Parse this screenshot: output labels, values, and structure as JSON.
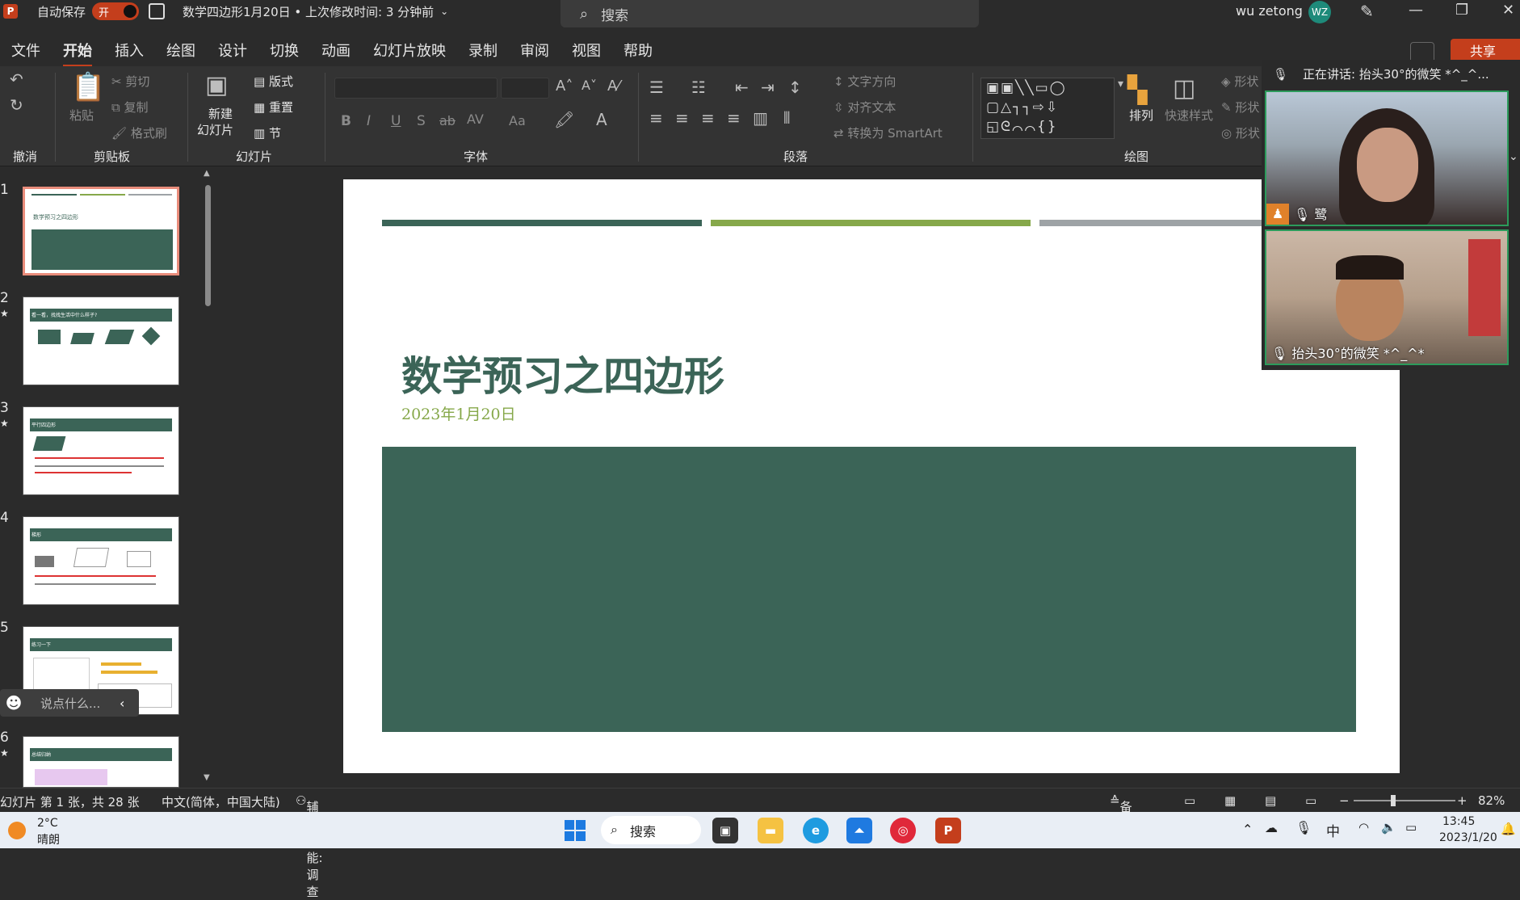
{
  "titlebar": {
    "app_icon": "P",
    "autosave_label": "自动保存",
    "autosave_state": "开",
    "doc_title": "数学四边形1月20日 • 上次修改时间: 3 分钟前",
    "search_placeholder": "搜索",
    "user_name": "wu zetong",
    "user_initials": "WZ"
  },
  "menu": {
    "tabs": [
      "文件",
      "开始",
      "插入",
      "绘图",
      "设计",
      "切换",
      "动画",
      "幻灯片放映",
      "录制",
      "审阅",
      "视图",
      "帮助"
    ],
    "share": "共享"
  },
  "ribbon": {
    "groups": {
      "undo": "撤消",
      "clipboard": "剪贴板",
      "slides": "幻灯片",
      "font": "字体",
      "paragraph": "段落",
      "drawing": "绘图"
    },
    "clipboard": {
      "paste": "粘贴",
      "cut": "剪切",
      "copy": "复制",
      "format_painter": "格式刷"
    },
    "slides": {
      "new_slide": "新建",
      "new_slide2": "幻灯片",
      "layout": "版式",
      "reset": "重置",
      "section": "节"
    },
    "font": {
      "bold": "B",
      "italic": "I",
      "underline": "U",
      "shadow": "S",
      "strike": "ab",
      "spacing": "AV",
      "case": "Aa"
    },
    "paragraph": {
      "text_direction": "文字方向",
      "align_text": "对齐文本",
      "smartart": "转换为 SmartArt"
    },
    "drawing": {
      "arrange": "排列",
      "quick_styles": "快速样式",
      "shape_fill": "形状",
      "shape_outline": "形状",
      "shape_effects": "形状"
    }
  },
  "slides_pane": {
    "numbers": [
      "1",
      "2",
      "3",
      "4",
      "5",
      "6"
    ],
    "thumb_titles": [
      "数学预习之四边形",
      "看一看，找找生活中什么样子?",
      "平行四边形",
      "梯形",
      "练习一下",
      "总结归纳"
    ],
    "chat_placeholder": "说点什么..."
  },
  "slide": {
    "title": "数学预习之四边形",
    "date": "2023年1月20日",
    "colors": {
      "dark_green": "#3b6457",
      "light_green": "#86a84a",
      "gray": "#9ea3a6"
    }
  },
  "video": {
    "speaking": "正在讲话: 抬头30°的微笑 *^_^...",
    "tile1_name": "鹭",
    "tile2_name": "抬头30°的微笑 *^_^*"
  },
  "statusbar": {
    "slide_info": "幻灯片 第 1 张，共 28 张",
    "language": "中文(简体，中国大陆)",
    "accessibility": "辅助功能: 调查",
    "notes": "备注",
    "zoom": "82%"
  },
  "taskbar": {
    "weather_temp": "2°C",
    "weather_desc": "晴朗",
    "search": "搜索",
    "ime": "中",
    "time": "13:45",
    "date": "2023/1/20"
  }
}
